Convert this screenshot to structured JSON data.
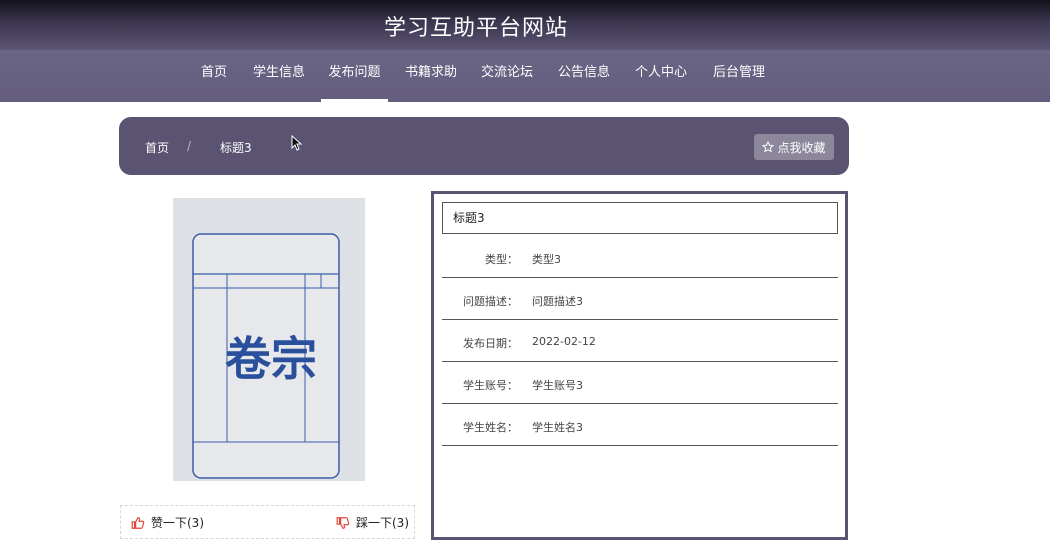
{
  "header": {
    "site_title": "学习互助平台网站"
  },
  "nav": {
    "items": [
      {
        "label": "首页"
      },
      {
        "label": "学生信息"
      },
      {
        "label": "发布问题"
      },
      {
        "label": "书籍求助"
      },
      {
        "label": "交流论坛"
      },
      {
        "label": "公告信息"
      },
      {
        "label": "个人中心"
      },
      {
        "label": "后台管理"
      }
    ],
    "active": "发布问题"
  },
  "breadcrumb": {
    "home": "首页",
    "separator": "/",
    "current": "标题3"
  },
  "actions": {
    "favorite_label": "点我收藏"
  },
  "photo": {
    "stamp_text": "卷宗"
  },
  "votes": {
    "like_label": "赞一下(3)",
    "dislike_label": "踩一下(3)"
  },
  "detail": {
    "title": "标题3",
    "fields": [
      {
        "label": "类型：",
        "value": "类型3"
      },
      {
        "label": "问题描述：",
        "value": "问题描述3"
      },
      {
        "label": "发布日期：",
        "value": "2022-02-12"
      },
      {
        "label": "学生账号：",
        "value": "学生账号3"
      },
      {
        "label": "学生姓名：",
        "value": "学生姓名3"
      }
    ]
  },
  "colors": {
    "accent": "#5b5372",
    "nav_bg": "#645d7e",
    "header_dark": "#14121a",
    "vote_icon": "#e0453a"
  }
}
